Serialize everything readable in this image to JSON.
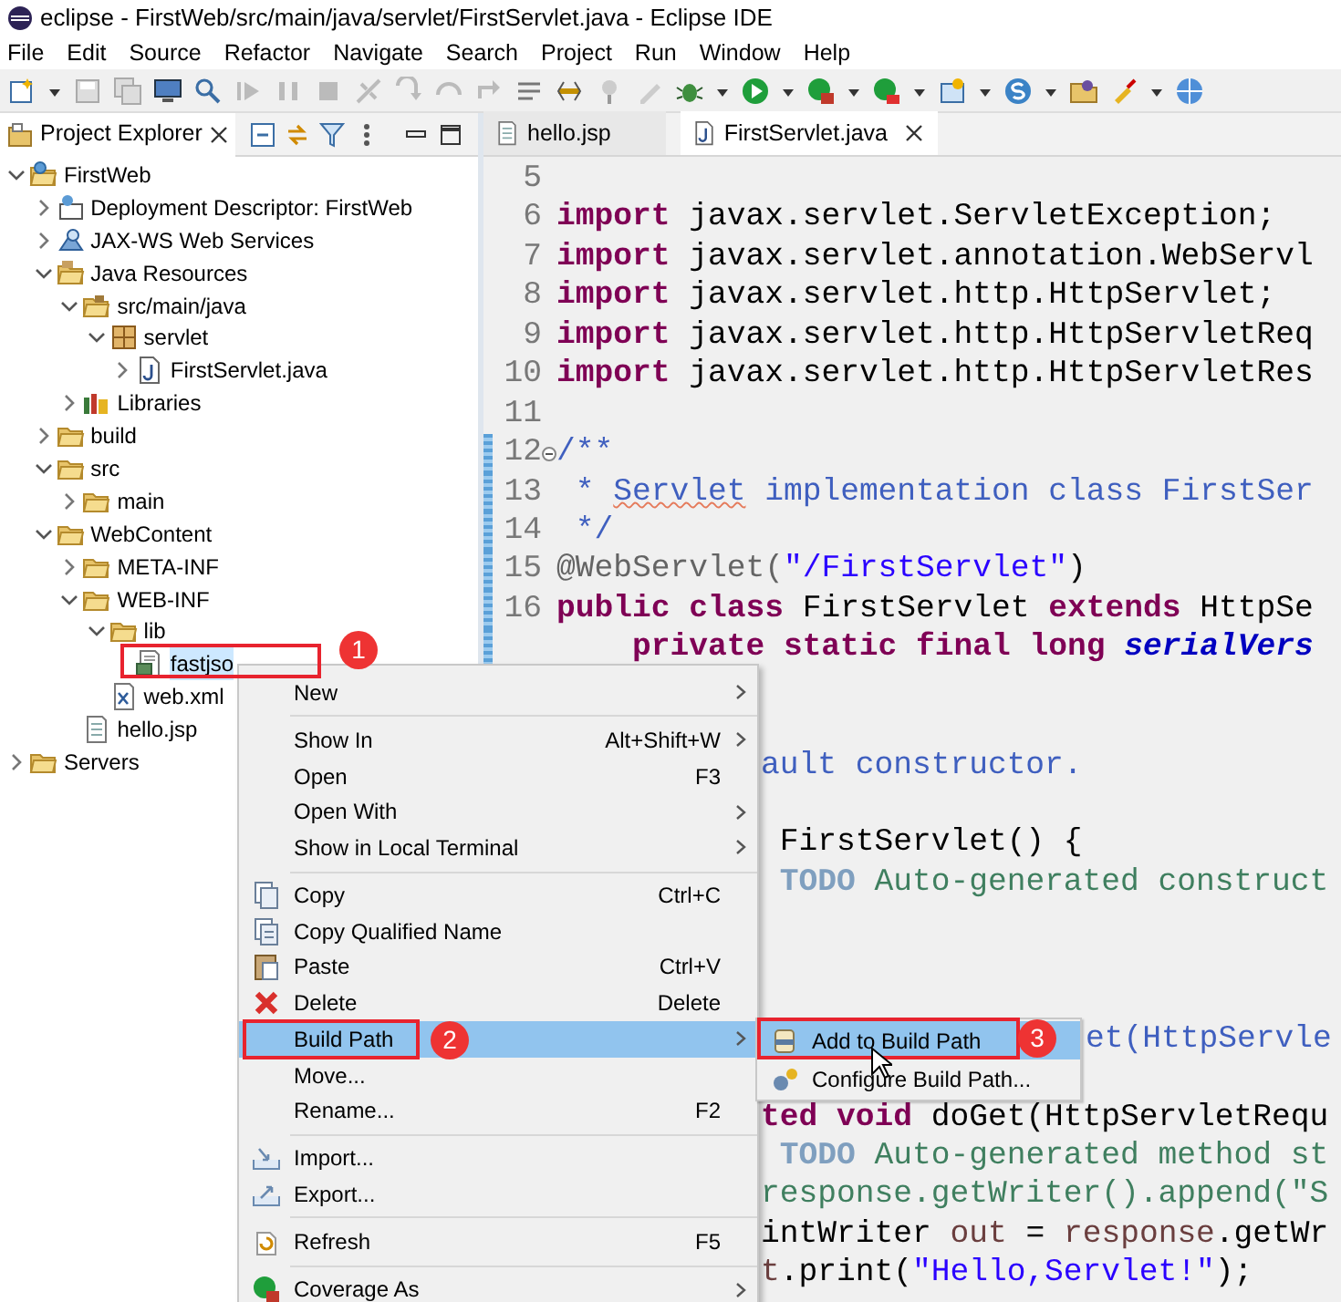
{
  "window": {
    "title": "eclipse -  FirstWeb/src/main/java/servlet/FirstServlet.java - Eclipse IDE"
  },
  "menu_bar": [
    "File",
    "Edit",
    "Source",
    "Refactor",
    "Navigate",
    "Search",
    "Project",
    "Run",
    "Window",
    "Help"
  ],
  "project_explorer": {
    "title": "Project Explorer",
    "tree": [
      {
        "label": "FirstWeb",
        "kind": "project",
        "expanded": true,
        "selected": false,
        "children": [
          {
            "label": "Deployment Descriptor: FirstWeb",
            "kind": "descriptor",
            "expanded": false,
            "selected": false
          },
          {
            "label": "JAX-WS Web Services",
            "kind": "webservices",
            "expanded": false,
            "selected": false
          },
          {
            "label": "Java Resources",
            "kind": "resources",
            "expanded": true,
            "selected": false,
            "children": [
              {
                "label": "src/main/java",
                "kind": "source",
                "expanded": true,
                "selected": false,
                "children": [
                  {
                    "label": "servlet",
                    "kind": "package",
                    "expanded": true,
                    "selected": false,
                    "children": [
                      {
                        "label": "FirstServlet.java",
                        "kind": "java",
                        "expanded": false,
                        "selected": false
                      }
                    ]
                  }
                ]
              },
              {
                "label": "Libraries",
                "kind": "libraries",
                "expanded": false,
                "selected": false
              }
            ]
          },
          {
            "label": "build",
            "kind": "folder",
            "expanded": false,
            "selected": false
          },
          {
            "label": "src",
            "kind": "folder",
            "expanded": true,
            "selected": false,
            "children": [
              {
                "label": "main",
                "kind": "folder",
                "expanded": false,
                "selected": false
              }
            ]
          },
          {
            "label": "WebContent",
            "kind": "folder",
            "expanded": true,
            "selected": false,
            "children": [
              {
                "label": "META-INF",
                "kind": "folder",
                "expanded": false,
                "selected": false
              },
              {
                "label": "WEB-INF",
                "kind": "folder",
                "expanded": true,
                "selected": false,
                "children": [
                  {
                    "label": "lib",
                    "kind": "folder",
                    "expanded": true,
                    "selected": false,
                    "children": [
                      {
                        "label": "fastjso",
                        "kind": "archive",
                        "selected": true
                      }
                    ]
                  },
                  {
                    "label": "web.xml",
                    "kind": "xml",
                    "selected": false
                  }
                ]
              },
              {
                "label": "hello.jsp",
                "kind": "jsp",
                "selected": false
              }
            ]
          }
        ]
      },
      {
        "label": "Servers",
        "kind": "folder",
        "expanded": false,
        "selected": false
      }
    ]
  },
  "editor": {
    "tabs": [
      {
        "label": "hello.jsp",
        "selected": false
      },
      {
        "label": "FirstServlet.java",
        "selected": true,
        "closable": true
      }
    ],
    "lines": [
      {
        "number": "5",
        "kind": "full"
      },
      {
        "number": "6",
        "kind": "full",
        "tokens": [
          {
            "text": "import",
            "kind": "kw"
          },
          {
            "text": " javax.servlet.ServletException;",
            "kind": "plain"
          }
        ]
      },
      {
        "number": "7",
        "kind": "full",
        "tokens": [
          {
            "text": "import",
            "kind": "kw"
          },
          {
            "text": " javax.servlet.annotation.WebServl",
            "kind": "plain"
          }
        ]
      },
      {
        "number": "8",
        "kind": "full",
        "tokens": [
          {
            "text": "import",
            "kind": "kw"
          },
          {
            "text": " javax.servlet.http.HttpServlet;",
            "kind": "plain"
          }
        ]
      },
      {
        "number": "9",
        "kind": "full",
        "tokens": [
          {
            "text": "import",
            "kind": "kw"
          },
          {
            "text": " javax.servlet.http.HttpServletReq",
            "kind": "plain"
          }
        ]
      },
      {
        "number": "10",
        "kind": "full",
        "tokens": [
          {
            "text": "import",
            "kind": "kw"
          },
          {
            "text": " javax.servlet.http.HttpServletRes",
            "kind": "plain"
          }
        ]
      },
      {
        "number": "11",
        "kind": "full"
      },
      {
        "number": "12",
        "kind": "full",
        "changed": true,
        "folded": false,
        "tokens": [
          {
            "text": "/**",
            "kind": "doc"
          }
        ]
      },
      {
        "number": "13",
        "kind": "full",
        "changed": true,
        "tokens": [
          {
            "text": " * ",
            "kind": "doc"
          },
          {
            "text": "Servlet",
            "kind": "docmis"
          },
          {
            "text": " implementation class FirstSer",
            "kind": "doc"
          }
        ]
      },
      {
        "number": "14",
        "kind": "full",
        "changed": true,
        "tokens": [
          {
            "text": " */",
            "kind": "doc"
          }
        ]
      },
      {
        "number": "15",
        "kind": "full",
        "changed": true,
        "tokens": [
          {
            "text": "@WebServlet(",
            "kind": "anno"
          },
          {
            "text": "\"/FirstServlet\"",
            "kind": "str"
          },
          {
            "text": ")",
            "kind": "plain"
          }
        ]
      },
      {
        "number": "16",
        "kind": "full",
        "changed": true,
        "tokens": [
          {
            "text": "public class",
            "kind": "kw"
          },
          {
            "text": " FirstServlet ",
            "kind": "plain"
          },
          {
            "text": "extends",
            "kind": "kw"
          },
          {
            "text": " HttpSe",
            "kind": "plain"
          }
        ]
      },
      {
        "kind": "full",
        "changed": true,
        "tokens": [
          {
            "text": "    private static final long",
            "kind": "kw"
          },
          {
            "text": " serialVers",
            "kind": "field"
          }
        ]
      },
      {
        "kind": "behind_menu"
      },
      {
        "kind": "behind_menu"
      },
      {
        "kind": "behind_menu",
        "tokens": [
          {
            "text": "ault constructor.",
            "kind": "doc"
          }
        ]
      },
      {
        "kind": "behind_menu"
      },
      {
        "kind": "behind_menu",
        "tokens": [
          {
            "text": " FirstServlet() {",
            "kind": "plain"
          }
        ]
      },
      {
        "kind": "behind_menu",
        "tokens": [
          {
            "text": " TODO",
            "kind": "todo"
          },
          {
            "text": " Auto-generated construct",
            "kind": "comment"
          }
        ]
      },
      {
        "kind": "behind_menu"
      },
      {
        "kind": "behind_menu"
      },
      {
        "kind": "behind_menu"
      },
      {
        "kind": "behind_submenu",
        "tokens": [
          {
            "text": "et(HttpServle",
            "kind": "doc"
          }
        ]
      },
      {
        "kind": "behind_menu"
      },
      {
        "kind": "behind_menu",
        "tokens": [
          {
            "text": "ted void",
            "kind": "kw"
          },
          {
            "text": " doGet(HttpServletRequ",
            "kind": "plain"
          }
        ]
      },
      {
        "kind": "behind_menu",
        "tokens": [
          {
            "text": " TODO",
            "kind": "todo"
          },
          {
            "text": " Auto-generated method st",
            "kind": "comment"
          }
        ]
      },
      {
        "kind": "behind_menu",
        "tokens": [
          {
            "text": "response.getWriter().append(\"S",
            "kind": "comment"
          }
        ]
      },
      {
        "kind": "behind_menu",
        "tokens": [
          {
            "text": "intWriter ",
            "kind": "plain"
          },
          {
            "text": "out",
            "kind": "local"
          },
          {
            "text": " = ",
            "kind": "plain"
          },
          {
            "text": "response",
            "kind": "local"
          },
          {
            "text": ".getWr",
            "kind": "plain"
          }
        ]
      },
      {
        "kind": "behind_menu",
        "tokens": [
          {
            "text": "t",
            "kind": "local"
          },
          {
            "text": ".print(",
            "kind": "plain"
          },
          {
            "text": "\"Hello,Servlet!\"",
            "kind": "str"
          },
          {
            "text": ");",
            "kind": "plain"
          }
        ]
      }
    ]
  },
  "context_menu": {
    "items": [
      {
        "kind": "item",
        "label": "New",
        "submenu": true,
        "selected": false
      },
      {
        "kind": "separator"
      },
      {
        "kind": "item",
        "label": "Show In",
        "shortcut": "Alt+Shift+W",
        "submenu": true,
        "selected": false
      },
      {
        "kind": "item",
        "label": "Open",
        "shortcut": "F3",
        "selected": false
      },
      {
        "kind": "item",
        "label": "Open With",
        "submenu": true,
        "selected": false
      },
      {
        "kind": "item",
        "label": "Show in Local Terminal",
        "submenu": true,
        "selected": false
      },
      {
        "kind": "separator"
      },
      {
        "kind": "item",
        "label": "Copy",
        "shortcut": "Ctrl+C",
        "selected": false
      },
      {
        "kind": "item",
        "label": "Copy Qualified Name",
        "selected": false
      },
      {
        "kind": "item",
        "label": "Paste",
        "shortcut": "Ctrl+V",
        "selected": false
      },
      {
        "kind": "item",
        "label": "Delete",
        "shortcut": "Delete",
        "selected": false
      },
      {
        "kind": "item",
        "label": "Build Path",
        "submenu": true,
        "selected": true
      },
      {
        "kind": "item",
        "label": "Move...",
        "selected": false
      },
      {
        "kind": "item",
        "label": "Rename...",
        "shortcut": "F2",
        "selected": false
      },
      {
        "kind": "separator"
      },
      {
        "kind": "item",
        "label": "Import...",
        "selected": false
      },
      {
        "kind": "item",
        "label": "Export...",
        "selected": false
      },
      {
        "kind": "separator"
      },
      {
        "kind": "item",
        "label": "Refresh",
        "shortcut": "F5",
        "selected": false
      },
      {
        "kind": "separator"
      },
      {
        "kind": "item",
        "label": "Coverage As",
        "submenu": true,
        "selected": false
      }
    ]
  },
  "submenu": {
    "items": [
      {
        "label": "Add to Build Path",
        "selected": true
      },
      {
        "label": "Configure Build Path...",
        "selected": false
      }
    ]
  },
  "annotations": [
    {
      "label": "1"
    },
    {
      "label": "2"
    },
    {
      "label": "3"
    }
  ]
}
